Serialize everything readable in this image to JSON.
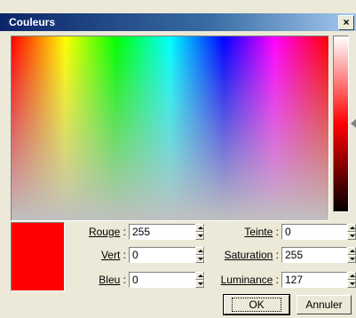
{
  "window": {
    "title": "Couleurs",
    "close_label": "×"
  },
  "color": {
    "rouge": {
      "label": "Rouge",
      "sep": " :",
      "value": "255"
    },
    "vert": {
      "label": "Vert",
      "sep": " :",
      "value": "0"
    },
    "bleu": {
      "label": "Bleu",
      "sep": " :",
      "value": "0"
    },
    "teinte": {
      "label": "Teinte",
      "sep": " :",
      "value": "0"
    },
    "saturation": {
      "label": "Saturation",
      "sep": " :",
      "value": "255"
    },
    "luminance": {
      "label": "Luminance",
      "sep": " :",
      "value": "127"
    },
    "swatch_color": "#ff0000"
  },
  "buttons": {
    "ok": "OK",
    "annuler": "Annuler"
  }
}
